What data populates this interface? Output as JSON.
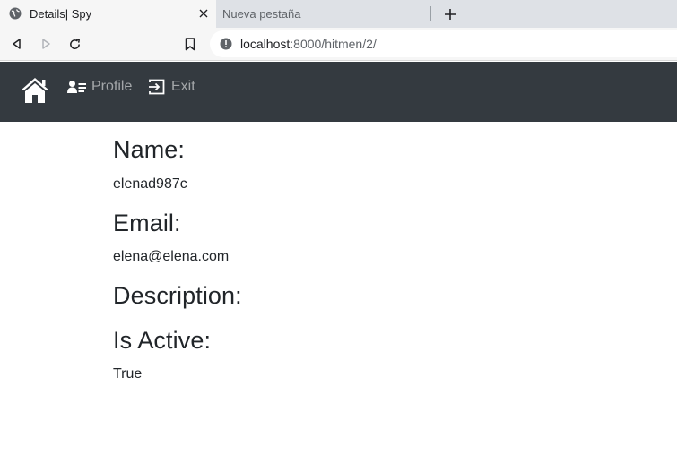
{
  "browser": {
    "tabs": [
      {
        "title": "Details| Spy",
        "active": true
      },
      {
        "title": "Nueva pestaña",
        "active": false
      }
    ],
    "url": {
      "host": "localhost",
      "rest": ":8000/hitmen/2/"
    }
  },
  "navbar": {
    "profile_label": "Profile",
    "exit_label": "Exit"
  },
  "details": {
    "name_label": "Name:",
    "name_value": "elenad987c",
    "email_label": "Email:",
    "email_value": "elena@elena.com",
    "description_label": "Description:",
    "description_value": "",
    "active_label": "Is Active:",
    "active_value": "True"
  },
  "colors": {
    "navbar": "#343a40",
    "text": "#212529",
    "nav_link": "rgba(255,255,255,0.55)"
  },
  "icons": [
    "globe-icon",
    "close-icon",
    "plus-icon",
    "back-icon",
    "forward-icon",
    "reload-icon",
    "bookmark-icon",
    "info-icon",
    "home-icon",
    "profile-icon",
    "exit-icon"
  ]
}
